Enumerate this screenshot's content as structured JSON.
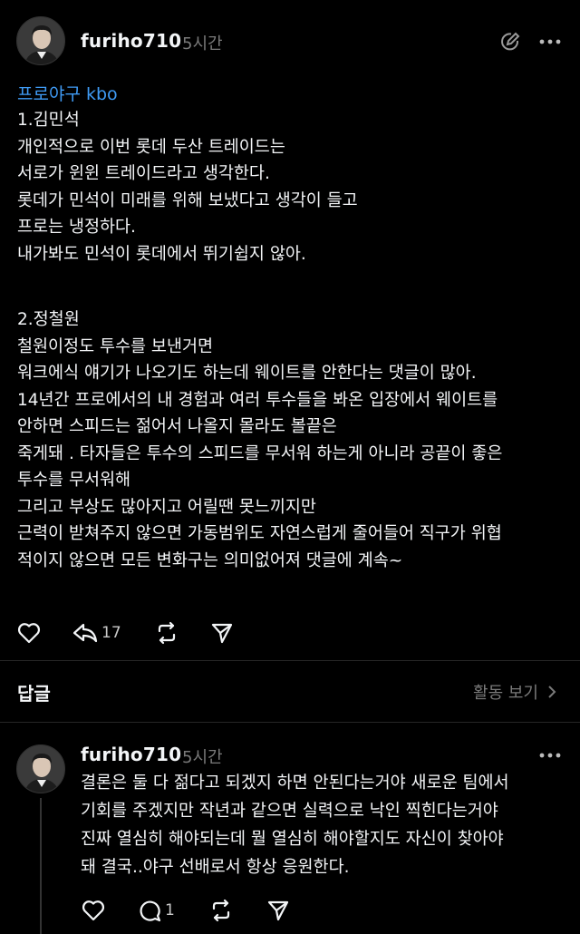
{
  "post": {
    "username": "furiho710",
    "time": "5시간",
    "tag": "프로야구 kbo",
    "paragraphs": [
      [
        "1.김민석",
        "개인적으로 이번 롯데 두산 트레이드는",
        "서로가 윈윈 트레이드라고 생각한다.",
        "롯데가 민석이 미래를 위해 보냈다고 생각이 들고",
        "프로는 냉정하다.",
        "내가봐도 민석이 롯데에서 뛰기쉽지 않아."
      ],
      [
        "2.정철원",
        "철원이정도 투수를 보낸거면",
        "워크에식 얘기가 나오기도 하는데 웨이트를 안한다는 댓글이 많아.",
        "14년간 프로에서의 내 경험과 여러 투수들을 봐온 입장에서 웨이트를",
        "안하면 스피드는 젊어서 나올지 몰라도 볼끝은",
        "죽게돼 . 타자들은 투수의 스피드를 무서워 하는게 아니라 공끝이 좋은",
        "투수를 무서워해",
        "그리고 부상도 많아지고 어릴땐 못느끼지만",
        "근력이 받쳐주지 않으면 가동범위도 자연스럽게 줄어들어 직구가 위협",
        "적이지 않으면 모든 변화구는 의미없어져  댓글에 계속~"
      ]
    ],
    "repost_count": "17",
    "icons": [
      "edit-circle-icon",
      "more-icon",
      "heart-icon",
      "reply-arrow-icon",
      "repost-icon",
      "send-icon"
    ]
  },
  "replies_section": {
    "title": "답글",
    "activity_label": "활동 보기"
  },
  "reply": {
    "username": "furiho710",
    "time": "5시간",
    "lines": [
      "결론은 둘 다 젊다고 되겠지 하면 안된다는거야 새로운 팀에서",
      "기회를 주겠지만 작년과 같으면 실력으로 낙인  찍힌다는거야",
      "진짜 열심히 해야되는데 뭘 열심히 해야할지도 자신이 찾아야",
      "돼 결국..야구 선배로서 항상 응원한다."
    ],
    "comment_count": "1"
  },
  "colors": {
    "background": "#000000",
    "text": "#f3f5f7",
    "muted": "#7a7a7a",
    "link": "#3f9bf5"
  }
}
